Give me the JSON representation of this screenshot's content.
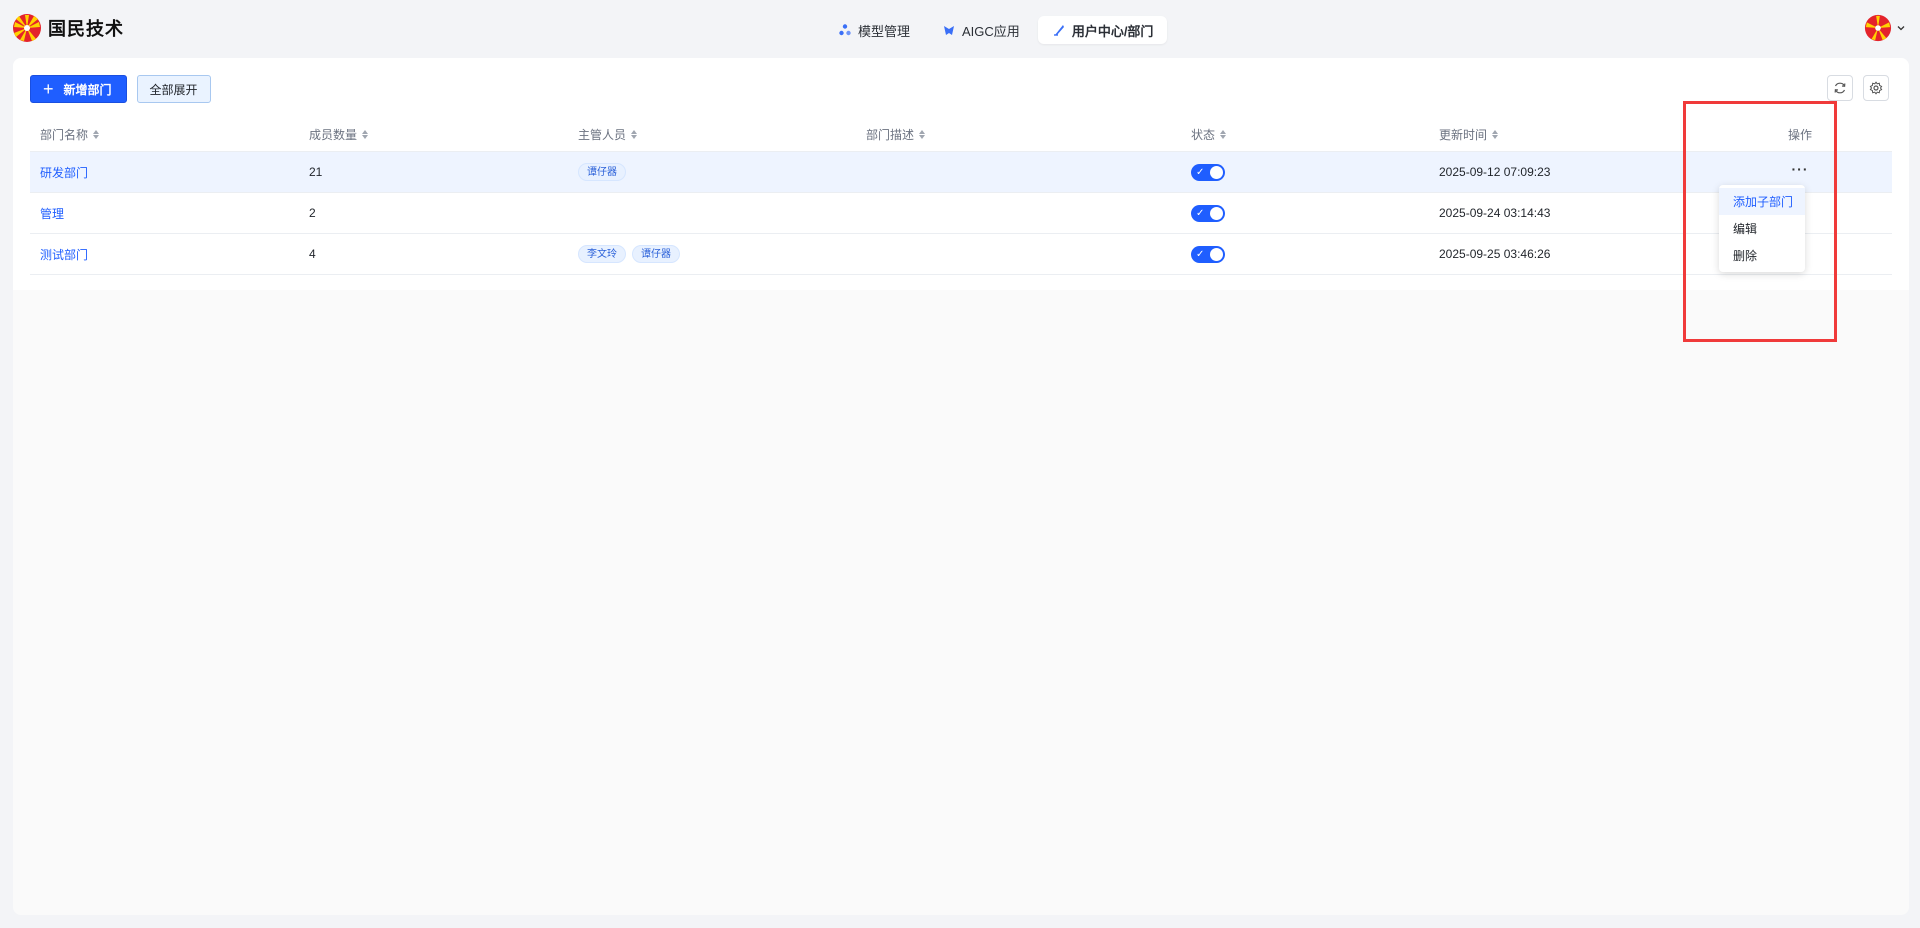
{
  "brand": {
    "name": "国民技术"
  },
  "nav": {
    "tabs": [
      {
        "label": "模型管理",
        "icon": "model-icon"
      },
      {
        "label": "AIGC应用",
        "icon": "aigc-icon"
      },
      {
        "label": "用户中心/部门",
        "icon": "user-center-icon"
      }
    ],
    "active_index": 2
  },
  "toolbar": {
    "add_label": "新增部门",
    "expand_label": "全部展开"
  },
  "table": {
    "headers": [
      "部门名称",
      "成员数量",
      "主管人员",
      "部门描述",
      "状态",
      "更新时间",
      "操作"
    ],
    "rows": [
      {
        "name": "研发部门",
        "count": "21",
        "managers": [
          "谭仔器"
        ],
        "desc": "",
        "status": true,
        "updated": "2025-09-12 07:09:23"
      },
      {
        "name": "管理",
        "count": "2",
        "managers": [],
        "desc": "",
        "status": true,
        "updated": "2025-09-24 03:14:43"
      },
      {
        "name": "测试部门",
        "count": "4",
        "managers": [
          "李文玲",
          "谭仔器"
        ],
        "desc": "",
        "status": true,
        "updated": "2025-09-25 03:46:26"
      }
    ],
    "more_label": "···"
  },
  "dropdown": {
    "items": [
      "添加子部门",
      "编辑",
      "删除"
    ]
  },
  "colors": {
    "accent": "#1f5eff",
    "annotation": "#f03a3a"
  }
}
